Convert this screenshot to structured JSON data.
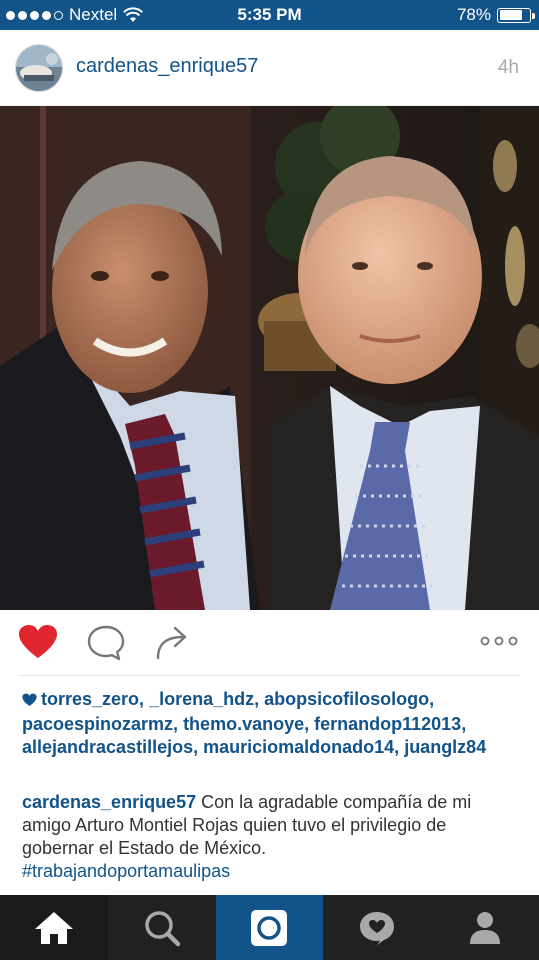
{
  "status_bar": {
    "carrier": "Nextel",
    "time": "5:35 PM",
    "battery": "78%",
    "battery_level": 0.78
  },
  "post": {
    "username": "cardenas_enrique57",
    "time_ago": "4h",
    "liked": true,
    "likes": {
      "users": [
        "torres_zero",
        "_lorena_hdz",
        "abopsicofilosologo",
        "pacoespinozarmz",
        "themo.vanoye",
        "fernandop112013",
        "allejandracastillejos",
        "mauriciomaldonado14",
        "juanglz84"
      ],
      "separator": ", "
    },
    "caption": {
      "username": "cardenas_enrique57",
      "text": "Con la agradable compañía de mi amigo Arturo Montiel Rojas quien tuvo el privilegio de gobernar el Estado de México.",
      "hashtag": "#trabajandoportamaulipas"
    }
  },
  "actions": {
    "like_icon": "heart-icon",
    "comment_icon": "comment-icon",
    "share_icon": "share-icon",
    "more_icon": "more-icon"
  },
  "tabbar": {
    "items": [
      {
        "name": "home",
        "icon": "home-icon",
        "active": true
      },
      {
        "name": "search",
        "icon": "search-icon",
        "active": false
      },
      {
        "name": "camera",
        "icon": "camera-icon",
        "active": false
      },
      {
        "name": "activity",
        "icon": "activity-icon",
        "active": false
      },
      {
        "name": "profile",
        "icon": "profile-icon",
        "active": false
      }
    ]
  },
  "colors": {
    "brand_blue": "#12538a",
    "like_red": "#e0262e",
    "tabbar_bg": "#1f2123"
  }
}
